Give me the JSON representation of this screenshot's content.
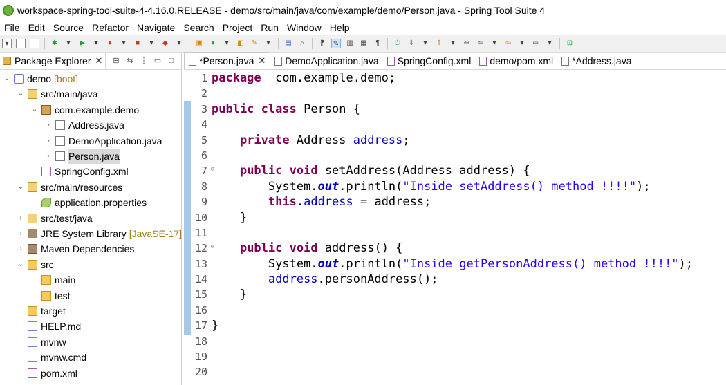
{
  "window": {
    "title": "workspace-spring-tool-suite-4-4.16.0.RELEASE - demo/src/main/java/com/example/demo/Person.java - Spring Tool Suite 4"
  },
  "menu": [
    {
      "label": "File",
      "u": "F",
      "rest": "ile"
    },
    {
      "label": "Edit",
      "u": "E",
      "rest": "dit"
    },
    {
      "label": "Source",
      "u": "S",
      "rest": "ource"
    },
    {
      "label": "Refactor",
      "u": "R",
      "rest": "efactor",
      "pre": ""
    },
    {
      "label": "Navigate",
      "u": "N",
      "rest": "avigate"
    },
    {
      "label": "Search",
      "u": "S",
      "rest": "earch"
    },
    {
      "label": "Project",
      "u": "P",
      "rest": "roject"
    },
    {
      "label": "Run",
      "u": "R",
      "rest": "un"
    },
    {
      "label": "Window",
      "u": "W",
      "rest": "indow"
    },
    {
      "label": "Help",
      "u": "H",
      "rest": "elp"
    }
  ],
  "explorer": {
    "title": "Package Explorer",
    "tree": [
      {
        "label": "demo",
        "suffix": "[boot]",
        "indent": 0,
        "chev": "v",
        "icon": "proj"
      },
      {
        "label": "src/main/java",
        "indent": 1,
        "chev": "v",
        "icon": "pkgroot"
      },
      {
        "label": "com.example.demo",
        "indent": 2,
        "chev": "v",
        "icon": "pkg"
      },
      {
        "label": "Address.java",
        "indent": 3,
        "chev": ">",
        "icon": "java"
      },
      {
        "label": "DemoApplication.java",
        "indent": 3,
        "chev": ">",
        "icon": "java"
      },
      {
        "label": "Person.java",
        "indent": 3,
        "chev": ">",
        "icon": "java",
        "selected": true
      },
      {
        "label": "SpringConfig.xml",
        "indent": 2,
        "chev": "",
        "icon": "xml"
      },
      {
        "label": "src/main/resources",
        "indent": 1,
        "chev": "v",
        "icon": "pkgroot"
      },
      {
        "label": "application.properties",
        "indent": 2,
        "chev": "",
        "icon": "props"
      },
      {
        "label": "src/test/java",
        "indent": 1,
        "chev": ">",
        "icon": "pkgroot"
      },
      {
        "label": "JRE System Library",
        "suffix": "[JavaSE-17]",
        "indent": 1,
        "chev": ">",
        "icon": "lib"
      },
      {
        "label": "Maven Dependencies",
        "indent": 1,
        "chev": ">",
        "icon": "lib"
      },
      {
        "label": "src",
        "indent": 1,
        "chev": "v",
        "icon": "folder"
      },
      {
        "label": "main",
        "indent": 2,
        "chev": "",
        "icon": "folder"
      },
      {
        "label": "test",
        "indent": 2,
        "chev": "",
        "icon": "folder"
      },
      {
        "label": "target",
        "indent": 1,
        "chev": "",
        "icon": "folder"
      },
      {
        "label": "HELP.md",
        "indent": 1,
        "chev": "",
        "icon": "file"
      },
      {
        "label": "mvnw",
        "indent": 1,
        "chev": "",
        "icon": "file"
      },
      {
        "label": "mvnw.cmd",
        "indent": 1,
        "chev": "",
        "icon": "file"
      },
      {
        "label": "pom.xml",
        "indent": 1,
        "chev": "",
        "icon": "xml"
      }
    ]
  },
  "editor": {
    "tabs": [
      {
        "label": "*Person.java",
        "active": true,
        "closable": true,
        "icon": "java"
      },
      {
        "label": "DemoApplication.java",
        "icon": "java"
      },
      {
        "label": "SpringConfig.xml",
        "icon": "xml"
      },
      {
        "label": "demo/pom.xml",
        "icon": "xml"
      },
      {
        "label": "*Address.java",
        "icon": "java"
      }
    ],
    "line_numbers": [
      "1",
      "2",
      "3",
      "4",
      "5",
      "6",
      "7",
      "8",
      "9",
      "10",
      "11",
      "12",
      "13",
      "14",
      "15",
      "16",
      "17",
      "18",
      "19",
      "20"
    ],
    "fold_lines": [
      7,
      12
    ],
    "code": [
      [
        [
          "kw",
          "package"
        ],
        [
          "",
          "  com.example.demo;"
        ]
      ],
      [],
      [
        [
          "kw",
          "public"
        ],
        [
          "",
          " "
        ],
        [
          "kw",
          "class"
        ],
        [
          "",
          " Person {"
        ]
      ],
      [],
      [
        [
          "",
          "    "
        ],
        [
          "kw",
          "private"
        ],
        [
          "",
          " Address "
        ],
        [
          "fld",
          "address"
        ],
        [
          "",
          ";"
        ]
      ],
      [],
      [
        [
          "",
          "    "
        ],
        [
          "kw",
          "public"
        ],
        [
          "",
          " "
        ],
        [
          "kw",
          "void"
        ],
        [
          "",
          " setAddress(Address address) {"
        ]
      ],
      [
        [
          "",
          "        System."
        ],
        [
          "st",
          "out"
        ],
        [
          "",
          ".println("
        ],
        [
          "str",
          "\"Inside setAddress() method !!!!\""
        ],
        [
          "",
          ");"
        ]
      ],
      [
        [
          "",
          "        "
        ],
        [
          "kw",
          "this"
        ],
        [
          "",
          "."
        ],
        [
          "fld",
          "address"
        ],
        [
          "",
          " = address;"
        ]
      ],
      [
        [
          "",
          "    }"
        ]
      ],
      [],
      [
        [
          "",
          "    "
        ],
        [
          "kw",
          "public"
        ],
        [
          "",
          " "
        ],
        [
          "kw",
          "void"
        ],
        [
          "",
          " address() {"
        ]
      ],
      [
        [
          "",
          "        System."
        ],
        [
          "st",
          "out"
        ],
        [
          "",
          ".println("
        ],
        [
          "str",
          "\"Inside getPersonAddress() method !!!!\""
        ],
        [
          "",
          ");"
        ]
      ],
      [
        [
          "",
          "        "
        ],
        [
          "fld",
          "address"
        ],
        [
          "",
          ".personAddress();"
        ]
      ],
      [
        [
          "",
          "    }"
        ]
      ],
      [],
      [
        [
          "",
          "}"
        ]
      ],
      [],
      [],
      []
    ]
  }
}
